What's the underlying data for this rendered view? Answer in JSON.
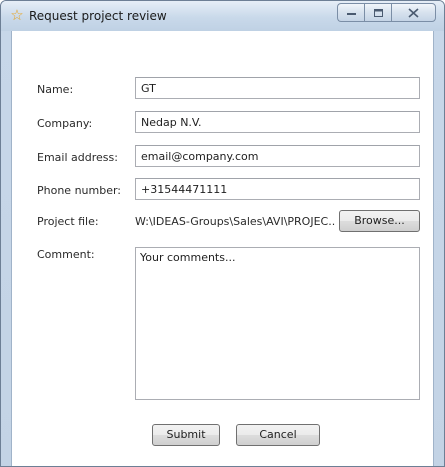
{
  "window": {
    "title": "Request project review",
    "icon": "star-icon"
  },
  "form": {
    "name_label": "Name:",
    "name_value": "GT",
    "company_label": "Company:",
    "company_value": "Nedap N.V.",
    "email_label": "Email address:",
    "email_value": "email@company.com",
    "phone_label": "Phone number:",
    "phone_value": "+31544471111",
    "project_file_label": "Project file:",
    "project_file_value": "W:\\IDEAS-Groups\\Sales\\AVI\\PROJEC...",
    "browse_label": "Browse...",
    "comment_label": "Comment:",
    "comment_value": "Your comments..."
  },
  "actions": {
    "submit_label": "Submit",
    "cancel_label": "Cancel"
  },
  "colors": {
    "frame": "#c7d7e9",
    "icon_accent": "#e8a21c"
  }
}
